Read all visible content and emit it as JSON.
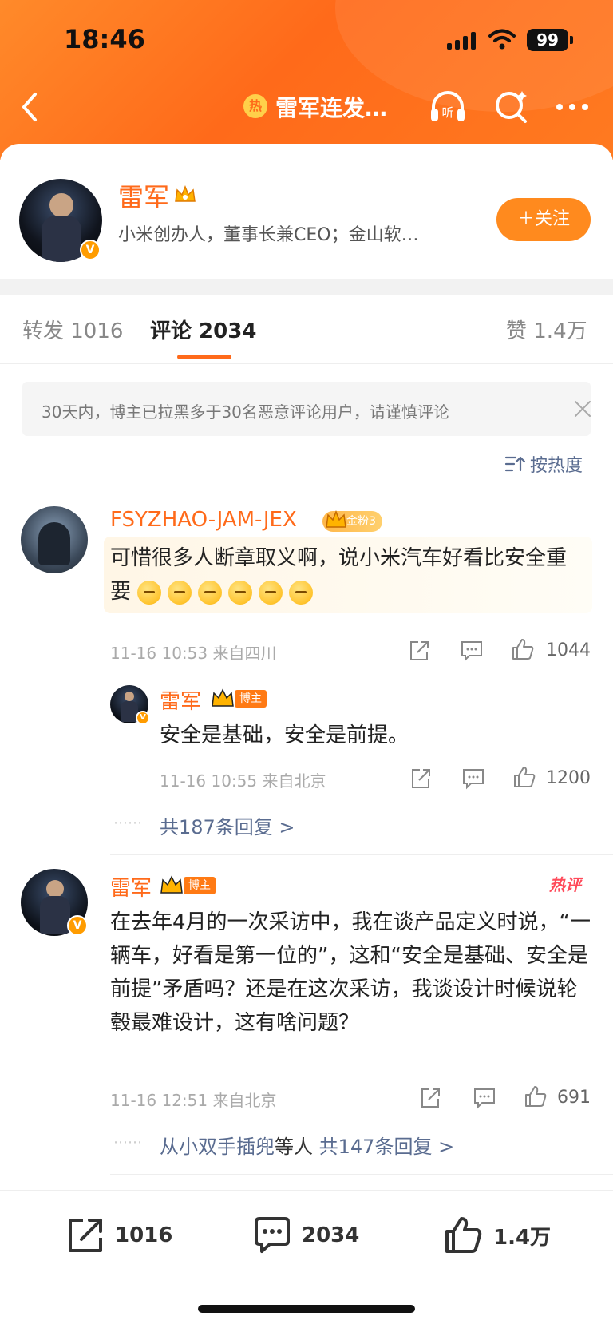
{
  "status_bar": {
    "time": "18:46",
    "battery": "99"
  },
  "nav": {
    "hot_badge": "热",
    "title": "雷军连发…"
  },
  "profile": {
    "name": "雷军",
    "description": "小米创办人，董事长兼CEO；金山软…",
    "follow_label": "＋关注",
    "verified_badge": "V"
  },
  "tabs": [
    {
      "label": "转发 1016"
    },
    {
      "label": "评论 2034"
    },
    {
      "label": "赞 1.4万"
    }
  ],
  "notice": {
    "text": "30天内，博主已拉黑多于30名恶意评论用户，请谨慎评论"
  },
  "sort": {
    "label": "按热度"
  },
  "comments": [
    {
      "author": "FSYZHAO-JAM-JEX",
      "badge": "金粉3",
      "text": "可惜很多人断章取义啊，说小米汽车好看比安全重要",
      "emoji_count": 6,
      "time": "11-16 10:53",
      "location": "来自四川",
      "likes": "1044",
      "reply": {
        "author": "雷军",
        "badge": "博主",
        "text": "安全是基础，安全是前提。",
        "time": "11-16 10:55",
        "location": "来自北京",
        "likes": "1200"
      },
      "more_replies": "共187条回复 >"
    },
    {
      "author": "雷军",
      "badge": "博主",
      "hot_tag": "热评",
      "text": "在去年4月的一次采访中，我在谈产品定义时说，“一辆车，好看是第一位的”，这和“安全是基础、安全是前提”矛盾吗？还是在这次采访，我谈设计时候说轮毂最难设计，这有啥问题？",
      "time": "11-16 12:51",
      "location": "来自北京",
      "likes": "691",
      "replies_from": "从小双手插兜",
      "replies_suffix": "等人",
      "more_replies": "共147条回复 >"
    }
  ],
  "bottom_bar": {
    "reposts": "1016",
    "comments": "2034",
    "likes": "1.4万"
  },
  "colors": {
    "accent": "#ff6a1a",
    "link": "#5a6c90"
  }
}
